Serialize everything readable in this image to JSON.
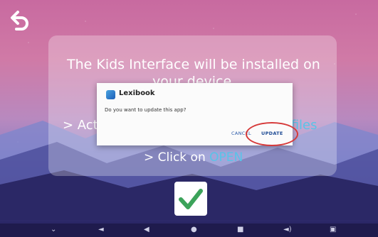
{
  "panel": {
    "line1": "The Kids Interface will be installed on",
    "line2": "your device",
    "line3_prefix": "> Act",
    "line3_suffix": "l files",
    "line4": "",
    "line5_prefix": "> Click on ",
    "line5_link": "OPEN"
  },
  "dialog": {
    "app_name": "Lexibook",
    "icon": "lexibook-app-icon",
    "message": "Do you want to update this app?",
    "cancel_label": "CANCEL",
    "update_label": "UPDATE"
  },
  "annotation": {
    "highlight_color": "#d63a3a"
  },
  "confirm": {
    "icon": "checkmark-icon",
    "color": "#3ca35a"
  },
  "navbar": {
    "items": [
      {
        "icon": "chevron-down-icon"
      },
      {
        "icon": "volume-down-icon"
      },
      {
        "icon": "back-triangle-icon"
      },
      {
        "icon": "home-circle-icon"
      },
      {
        "icon": "recents-square-icon"
      },
      {
        "icon": "volume-up-icon"
      },
      {
        "icon": "rotate-screen-icon"
      }
    ]
  },
  "colors": {
    "accent": "#58c4e8",
    "dialog_button": "#2a5aa8"
  }
}
